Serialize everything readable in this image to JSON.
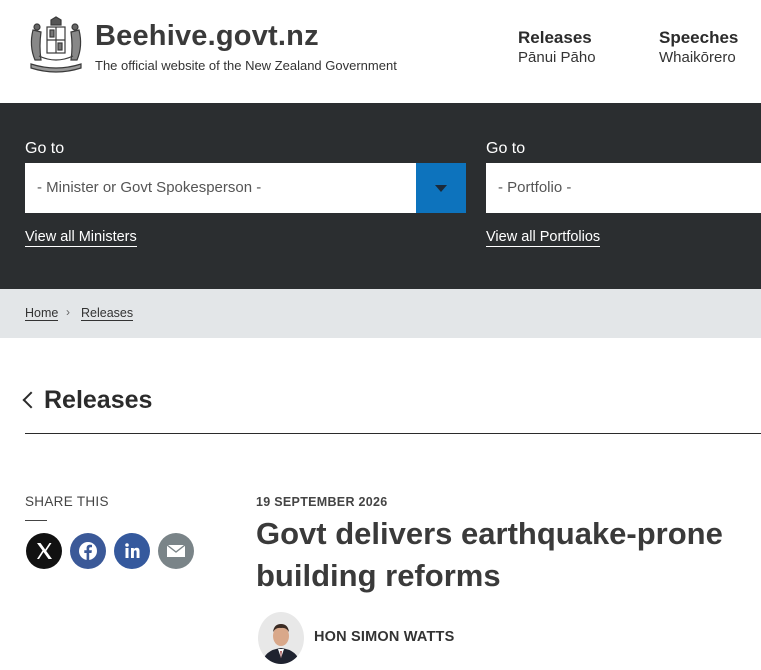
{
  "header": {
    "site_title": "Beehive.govt.nz",
    "site_subtitle": "The official website of the New Zealand Government",
    "logo_icon": "nz-coat-of-arms",
    "nav": [
      {
        "label": "Releases",
        "sublabel": "Pānui Pāho"
      },
      {
        "label": "Speeches",
        "sublabel": "Whaikōrero"
      }
    ]
  },
  "goto": {
    "minister": {
      "label": "Go to",
      "select_value": "- Minister or Govt Spokesperson -",
      "view_all": "View all Ministers"
    },
    "portfolio": {
      "label": "Go to",
      "select_value": "- Portfolio -",
      "view_all": "View all Portfolios"
    }
  },
  "breadcrumb": [
    "Home",
    "Releases"
  ],
  "back_link": "Releases",
  "share": {
    "title": "SHARE THIS",
    "buttons": [
      "x-icon",
      "facebook-icon",
      "linkedin-icon",
      "email-icon"
    ]
  },
  "article": {
    "date": "19 SEPTEMBER 2026",
    "headline": "Govt delivers earthquake-prone building reforms",
    "minister": "HON SIMON WATTS"
  },
  "colors": {
    "band": "#2b2e30",
    "select_button": "#0d73bd",
    "breadcrumb_bg": "#e3e6e8",
    "facebook": "#3b5998",
    "linkedin": "#35599d",
    "email": "#7a8488"
  }
}
